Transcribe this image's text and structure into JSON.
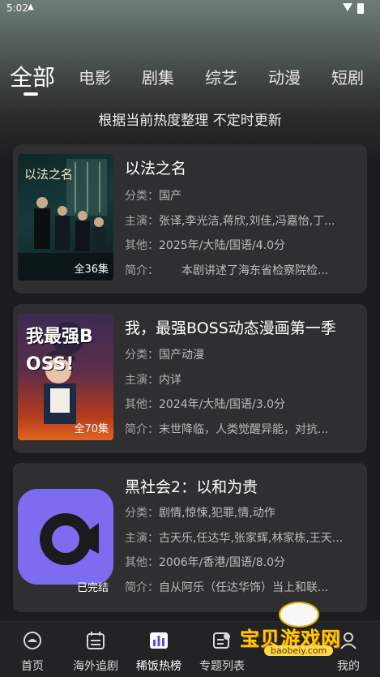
{
  "status": {
    "time": "5:02"
  },
  "tabs": [
    "全部",
    "电影",
    "剧集",
    "综艺",
    "动漫",
    "短剧"
  ],
  "subtitle": "根据当前热度整理 不定时更新",
  "cards": [
    {
      "title": "以法之名",
      "badge": "全36集",
      "category_label": "分类：",
      "category": "国产",
      "cast_label": "主演：",
      "cast": "张译,李光洁,蒋欣,刘佳,冯嘉怡,丁...",
      "other_label": "其他：",
      "other": "2025年/大陆/国语/4.0分",
      "intro_label": "简介：",
      "intro": "本剧讲述了海东省检察院检...",
      "poster_text": "以法之名"
    },
    {
      "title": "我，最强BOSS动态漫画第一季",
      "badge": "全70集",
      "category_label": "分类：",
      "category": "国产动漫",
      "cast_label": "主演：",
      "cast": "内详",
      "other_label": "其他：",
      "other": "2024年/大陆/国语/3.0分",
      "intro_label": "简介：",
      "intro": "末世降临，人类觉醒异能，对抗...",
      "poster_text": "我最强BOSS!"
    },
    {
      "title": "黑社会2：以和为贵",
      "badge": "已完结",
      "category_label": "分类：",
      "category": "剧情,惊悚,犯罪,情,动作",
      "cast_label": "主演：",
      "cast": "古天乐,任达华,张家辉,林家栋,王天...",
      "other_label": "其他：",
      "other": "2006年/香港/国语/8.0分",
      "intro_label": "简介：",
      "intro": "自从阿乐（任达华饰）当上和联..."
    }
  ],
  "nav": [
    {
      "label": "首页",
      "icon": "home-icon"
    },
    {
      "label": "海外追剧",
      "icon": "calendar-icon"
    },
    {
      "label": "稀饭热榜",
      "icon": "chart-icon"
    },
    {
      "label": "专题列表",
      "icon": "list-icon"
    },
    {
      "label": "我的",
      "icon": "user-icon"
    }
  ],
  "watermark": {
    "name": "宝贝游戏网",
    "url": "baobeiy.com"
  },
  "colors": {
    "accent": "#7d6bf0",
    "card_bg": "#2f2f31",
    "page_bg": "#1c1c1e"
  }
}
